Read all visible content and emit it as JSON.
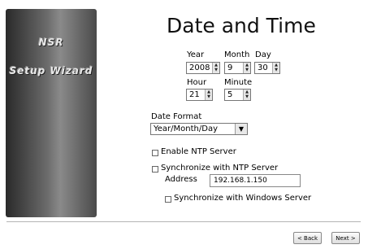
{
  "banner": {
    "line1": "NSR",
    "line2": "Setup Wizard"
  },
  "page_title": "Date and Time",
  "date": {
    "year_label": "Year",
    "year_value": "2008",
    "month_label": "Month",
    "month_value": "9",
    "day_label": "Day",
    "day_value": "30"
  },
  "time": {
    "hour_label": "Hour",
    "hour_value": "21",
    "minute_label": "Minute",
    "minute_value": "5"
  },
  "date_format": {
    "label": "Date Format",
    "value": "Year/Month/Day"
  },
  "ntp": {
    "enable_label": "Enable NTP Server",
    "sync_label": "Synchronize with NTP Server",
    "address_label": "Address",
    "address_value": "192.168.1.150",
    "windows_sync_label": "Synchronize with Windows Server"
  },
  "buttons": {
    "back": "< Back",
    "next": "Next >"
  }
}
